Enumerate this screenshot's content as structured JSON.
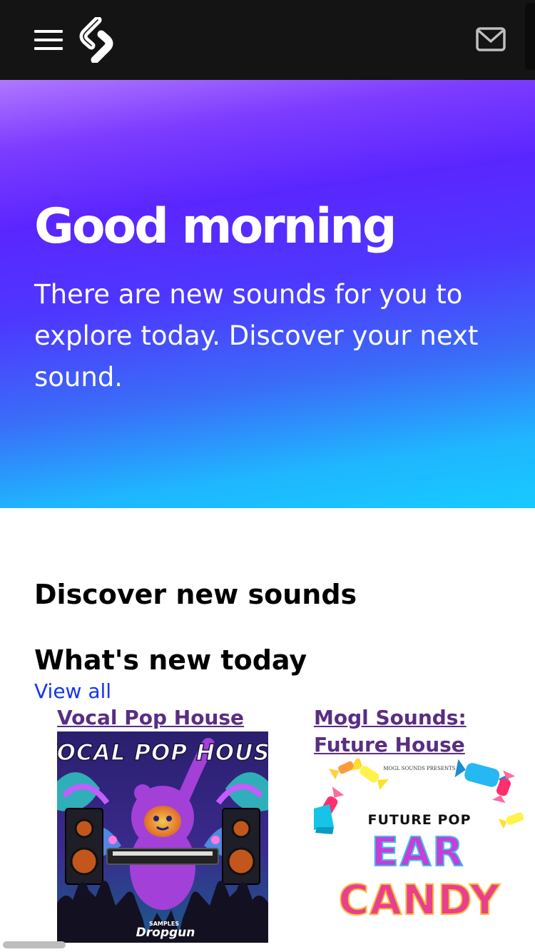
{
  "header": {
    "menu_icon": "hamburger-menu-icon",
    "logo_icon": "splice-logo-icon",
    "mail_icon": "envelope-icon",
    "background_color": "#141414"
  },
  "hero": {
    "title": "Good morning",
    "text": "There are new sounds for you to explore today. Discover your next sound.",
    "gradient_colors": [
      "#b078ff",
      "#5a26ff",
      "#3a6cf8",
      "#17caff"
    ]
  },
  "discover": {
    "heading": "Discover new sounds",
    "section_title": "What's new today",
    "view_all": "View all",
    "cards": [
      {
        "title": "Vocal Pop House",
        "cover_text": "VOCAL POP HOUSE",
        "cover_label": "Dropgun",
        "cover_sublabel": "SAMPLES"
      },
      {
        "title": "Mogl Sounds: Future House",
        "cover_top": "MOGL SOUNDS PRESENTS",
        "cover_line1": "FUTURE POP",
        "cover_line2": "EAR",
        "cover_line3": "CANDY"
      }
    ]
  },
  "colors": {
    "link": "#1435f0",
    "card_title": "#5a2d82"
  }
}
